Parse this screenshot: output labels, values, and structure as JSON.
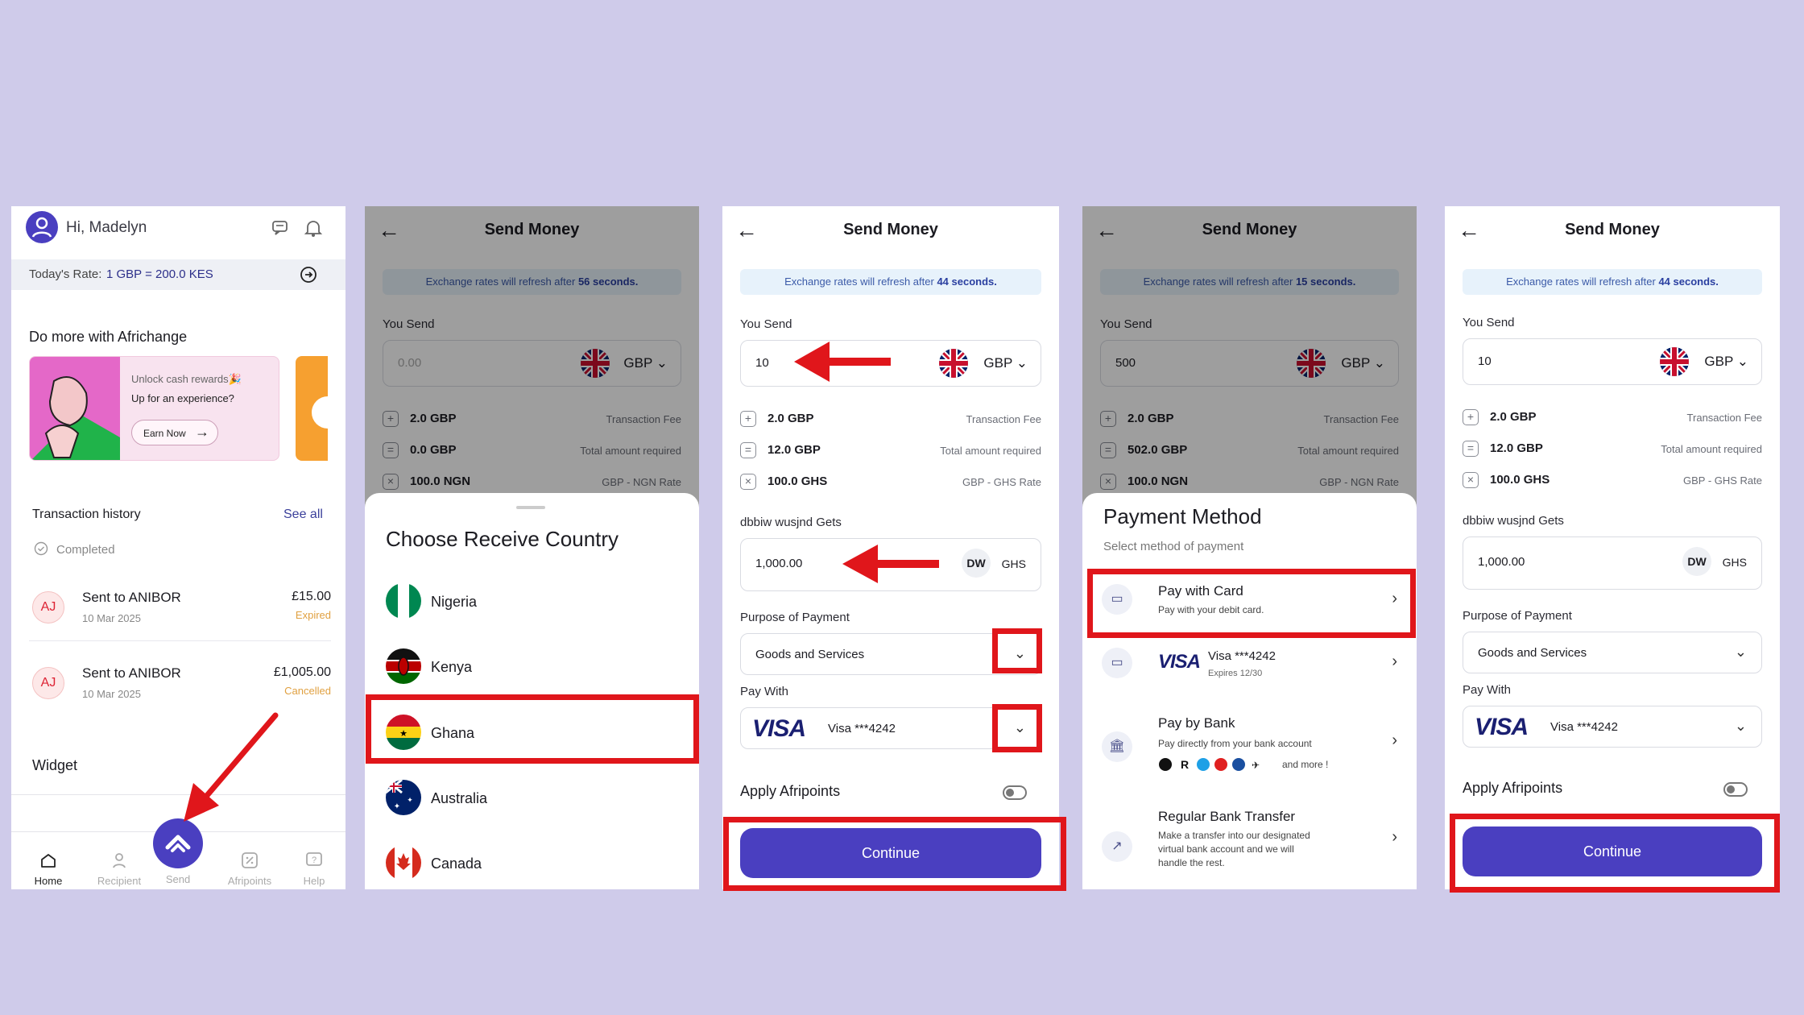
{
  "home": {
    "greeting": "Hi, Madelyn",
    "rate_label": "Today's Rate:",
    "rate_value": "1 GBP = 200.0 KES",
    "promo_title": "Do more with Africhange",
    "promo_line1": "Unlock cash rewards🎉",
    "promo_line2": "Up for an experience?",
    "promo_button": "Earn Now",
    "history_title": "Transaction history",
    "see_all": "See all",
    "filter": "Completed",
    "transactions": [
      {
        "initials": "AJ",
        "title": "Sent to ANIBOR",
        "date": "10 Mar 2025",
        "amount": "£15.00",
        "status": "Expired"
      },
      {
        "initials": "AJ",
        "title": "Sent to ANIBOR",
        "date": "10 Mar 2025",
        "amount": "£1,005.00",
        "status": "Cancelled"
      }
    ],
    "widget": "Widget",
    "nav": [
      "Home",
      "Recipient",
      "Send",
      "Afripoints",
      "Help"
    ]
  },
  "send_country": {
    "header": "Send Money",
    "banner_prefix": "Exchange rates will refresh after ",
    "banner_seconds": "56 seconds.",
    "you_send": "You Send",
    "amount_placeholder": "0.00",
    "currency": "GBP",
    "fees": [
      {
        "icon": "+",
        "amount": "2.0 GBP",
        "desc": "Transaction Fee"
      },
      {
        "icon": "=",
        "amount": "0.0 GBP",
        "desc": "Total amount required"
      },
      {
        "icon": "×",
        "amount": "100.0 NGN",
        "desc": "GBP - NGN Rate"
      }
    ],
    "sheet_title": "Choose Receive Country",
    "countries": [
      "Nigeria",
      "Kenya",
      "Ghana",
      "Australia",
      "Canada"
    ]
  },
  "send_filled": {
    "header": "Send Money",
    "banner_prefix": "Exchange rates will refresh after ",
    "banner_seconds": "44 seconds.",
    "you_send": "You Send",
    "amount": "10",
    "currency": "GBP",
    "fees": [
      {
        "icon": "+",
        "amount": "2.0 GBP",
        "desc": "Transaction Fee"
      },
      {
        "icon": "=",
        "amount": "12.0 GBP",
        "desc": "Total amount required"
      },
      {
        "icon": "×",
        "amount": "100.0 GHS",
        "desc": "GBP - GHS Rate"
      }
    ],
    "gets_label": "dbbiw wusjnd Gets",
    "gets_amount": "1,000.00",
    "gets_badge": "DW",
    "gets_currency": "GHS",
    "purpose_label": "Purpose of Payment",
    "purpose_value": "Goods and Services",
    "pay_with_label": "Pay With",
    "visa_logo": "VISA",
    "card": "Visa ***4242",
    "afripoints": "Apply Afripoints",
    "continue": "Continue"
  },
  "payment_method": {
    "header": "Send Money",
    "banner_prefix": "Exchange rates will refresh after ",
    "banner_seconds": "15 seconds.",
    "you_send": "You Send",
    "amount": "500",
    "currency": "GBP",
    "fees": [
      {
        "icon": "+",
        "amount": "2.0 GBP",
        "desc": "Transaction Fee"
      },
      {
        "icon": "=",
        "amount": "502.0 GBP",
        "desc": "Total amount required"
      },
      {
        "icon": "×",
        "amount": "100.0 NGN",
        "desc": "GBP - NGN Rate"
      }
    ],
    "sheet_title": "Payment Method",
    "sheet_sub": "Select method of payment",
    "options": [
      {
        "title": "Pay with Card",
        "sub": "Pay with your debit card."
      },
      {
        "title": "Visa ***4242",
        "sub": "Expires 12/30"
      },
      {
        "title": "Pay by Bank",
        "sub": "Pay directly from your bank account",
        "extra": "and more !"
      },
      {
        "title": "Regular Bank Transfer",
        "sub1": "Make a transfer into our designated",
        "sub2": "virtual bank account and we will",
        "sub3": "handle the rest."
      }
    ]
  },
  "send_final": {
    "header": "Send Money",
    "banner_prefix": "Exchange rates will refresh after ",
    "banner_seconds": "44 seconds.",
    "you_send": "You Send",
    "amount": "10",
    "currency": "GBP",
    "fees": [
      {
        "icon": "+",
        "amount": "2.0 GBP",
        "desc": "Transaction Fee"
      },
      {
        "icon": "=",
        "amount": "12.0 GBP",
        "desc": "Total amount required"
      },
      {
        "icon": "×",
        "amount": "100.0 GHS",
        "desc": "GBP - GHS Rate"
      }
    ],
    "gets_label": "dbbiw wusjnd Gets",
    "gets_amount": "1,000.00",
    "gets_badge": "DW",
    "gets_currency": "GHS",
    "purpose_label": "Purpose of Payment",
    "purpose_value": "Goods and Services",
    "pay_with_label": "Pay With",
    "visa_logo": "VISA",
    "card": "Visa ***4242",
    "afripoints": "Apply Afripoints",
    "continue": "Continue"
  },
  "colors": {
    "accent": "#4a3fc0",
    "highlight": "#e0161b",
    "background": "#cfcbea"
  }
}
